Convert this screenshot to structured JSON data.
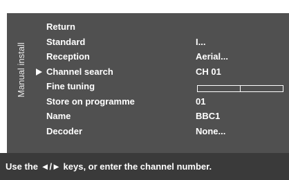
{
  "menu": {
    "side_label": "Manual install",
    "selected_index": 3,
    "items": [
      {
        "label": "Return",
        "value": ""
      },
      {
        "label": "Standard",
        "value": "I..."
      },
      {
        "label": "Reception",
        "value": "Aerial..."
      },
      {
        "label": "Channel search",
        "value": "CH 01"
      },
      {
        "label": "Fine tuning",
        "value": ""
      },
      {
        "label": "Store on programme",
        "value": "01"
      },
      {
        "label": "Name",
        "value": "BBC1"
      },
      {
        "label": "Decoder",
        "value": "None..."
      }
    ],
    "fine_tuning_level": 0.5
  },
  "hint": {
    "text": "Use the ◄/► keys, or enter the channel number."
  },
  "colors": {
    "panel": "#505050",
    "hint_bar": "#3a3a3a",
    "text": "#ffffff"
  }
}
